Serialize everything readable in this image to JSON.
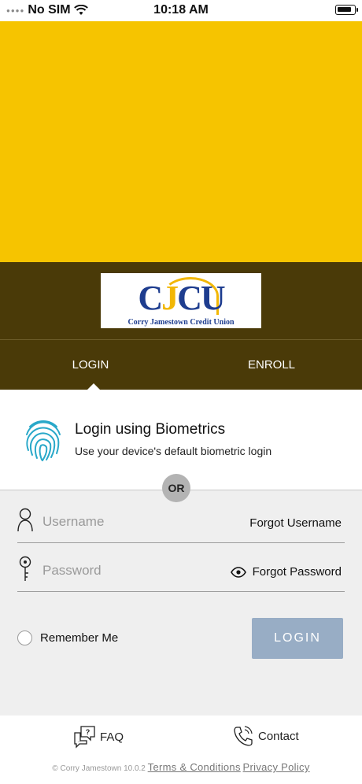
{
  "status_bar": {
    "carrier": "No SIM",
    "time": "10:18 AM"
  },
  "brand": {
    "logo_letters_a": "C",
    "logo_letters_b": "J",
    "logo_letters_c": "C",
    "logo_letters_d": "U",
    "logo_subtitle": "Corry Jamestown Credit Union"
  },
  "tabs": {
    "login": "LOGIN",
    "enroll": "ENROLL"
  },
  "biometrics": {
    "title": "Login using Biometrics",
    "subtitle": "Use your device's default biometric login"
  },
  "divider": {
    "or": "OR"
  },
  "form": {
    "username_placeholder": "Username",
    "password_placeholder": "Password",
    "forgot_username": "Forgot Username",
    "forgot_password": "Forgot Password",
    "remember_me": "Remember Me",
    "login_button": "LOGIN"
  },
  "footer": {
    "faq": "FAQ",
    "contact": "Contact",
    "copyright": "© Corry Jamestown 10.0.2",
    "terms": "Terms & Conditions",
    "privacy": "Privacy Policy"
  },
  "colors": {
    "hero": "#f6c400",
    "band": "#4a3a08",
    "login_button": "#98adc5",
    "fingerprint": "#29a8c9"
  }
}
